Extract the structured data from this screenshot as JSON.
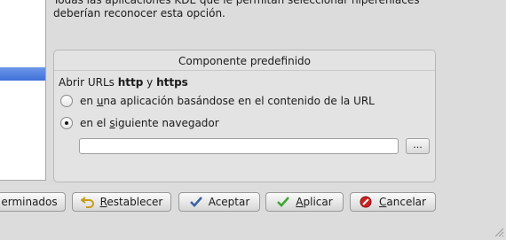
{
  "description": {
    "line1": "Todas las aplicaciones KDE que le permitan seleccionar hiperenlaces",
    "line2": "deberían reconocer esta opción."
  },
  "group": {
    "title": "Componente predefinido",
    "urls_prefix": "Abrir URLs ",
    "urls_http": "http",
    "urls_and": " y ",
    "urls_https": "https",
    "option1_pre": "en ",
    "option1_u": "u",
    "option1_post": "na aplicación basándose en el contenido de la URL",
    "option2_pre": "en el ",
    "option2_u": "s",
    "option2_post": "iguiente navegador",
    "selected_option": 2,
    "browser_value": "",
    "browse_button": "..."
  },
  "buttons": {
    "defaults": "erminados",
    "reset_u": "R",
    "reset_rest": "establecer",
    "ok": "Aceptar",
    "apply_u": "A",
    "apply_rest": "plicar",
    "cancel_u": "C",
    "cancel_rest": "ancelar"
  },
  "icons": {
    "reset": "undo-arrow-icon",
    "ok": "checkmark-icon",
    "apply": "green-checkmark-icon",
    "cancel": "cancel-icon"
  },
  "colors": {
    "selection": "#3f6fd8",
    "apply_green": "#3aa832",
    "cancel_red": "#cc2222",
    "ok_blue": "#3b5ea8"
  }
}
